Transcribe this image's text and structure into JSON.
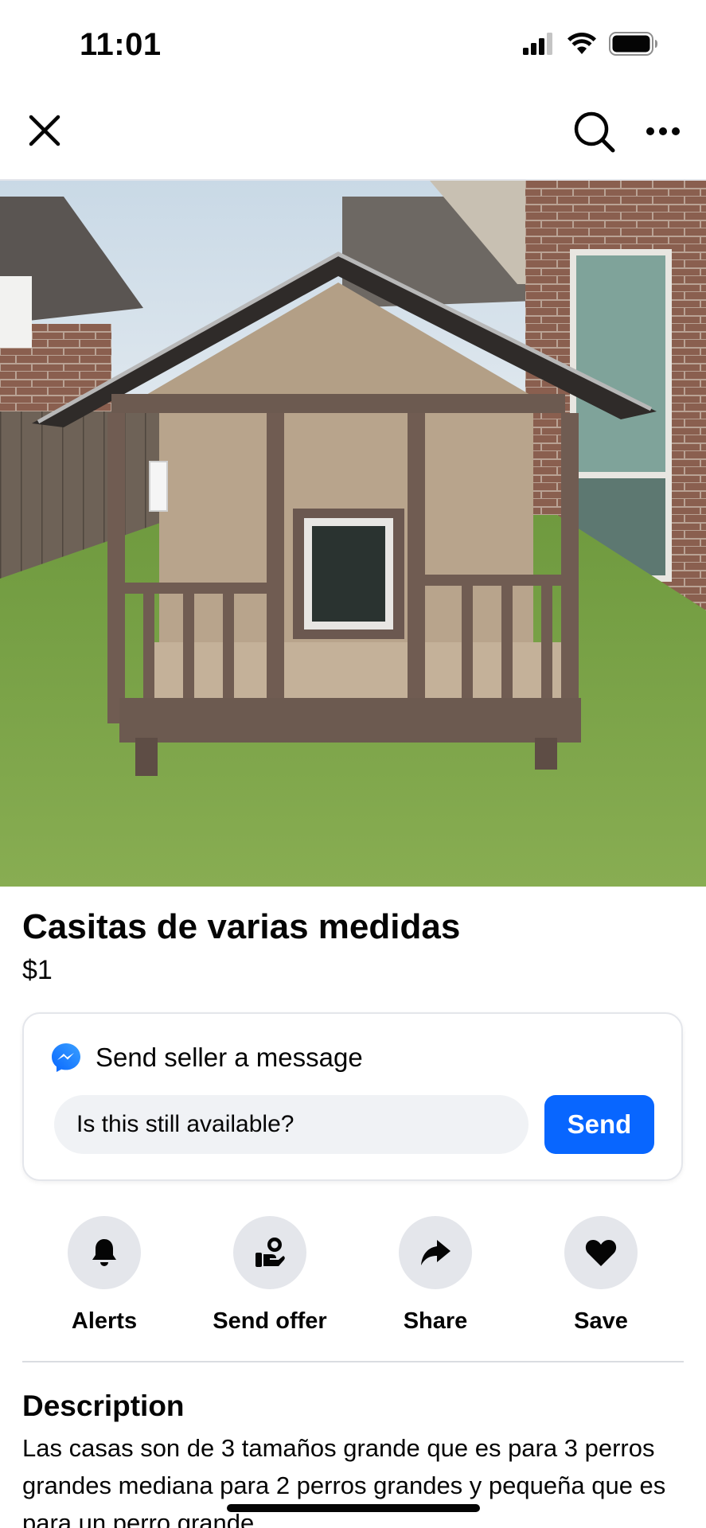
{
  "status_bar": {
    "time": "11:01",
    "icons": [
      "cellular-signal-icon",
      "wifi-icon",
      "battery-icon"
    ]
  },
  "nav": {
    "icons": [
      "close-icon",
      "search-icon",
      "more-options-icon"
    ]
  },
  "photo": {
    "carousel": {
      "total": 10,
      "active_index": 0
    }
  },
  "listing": {
    "title": "Casitas de varias medidas",
    "price": "$1"
  },
  "message_card": {
    "icon": "messenger-icon",
    "title": "Send seller a message",
    "input_value": "Is this still available?",
    "send_label": "Send"
  },
  "actions": [
    {
      "label": "Alerts",
      "icon": "bell-icon"
    },
    {
      "label": "Send offer",
      "icon": "offer-hand-icon"
    },
    {
      "label": "Share",
      "icon": "share-arrow-icon"
    },
    {
      "label": "Save",
      "icon": "heart-icon"
    }
  ],
  "description": {
    "heading": "Description",
    "text": "Las casas son de 3 tamaños grande que es para 3 perros grandes mediana para 2 perros grandes y pequeña que es para un perro grande"
  },
  "colors": {
    "accent": "#0866ff",
    "action_circle": "#e4e6eb",
    "input_bg": "#f0f2f5"
  }
}
